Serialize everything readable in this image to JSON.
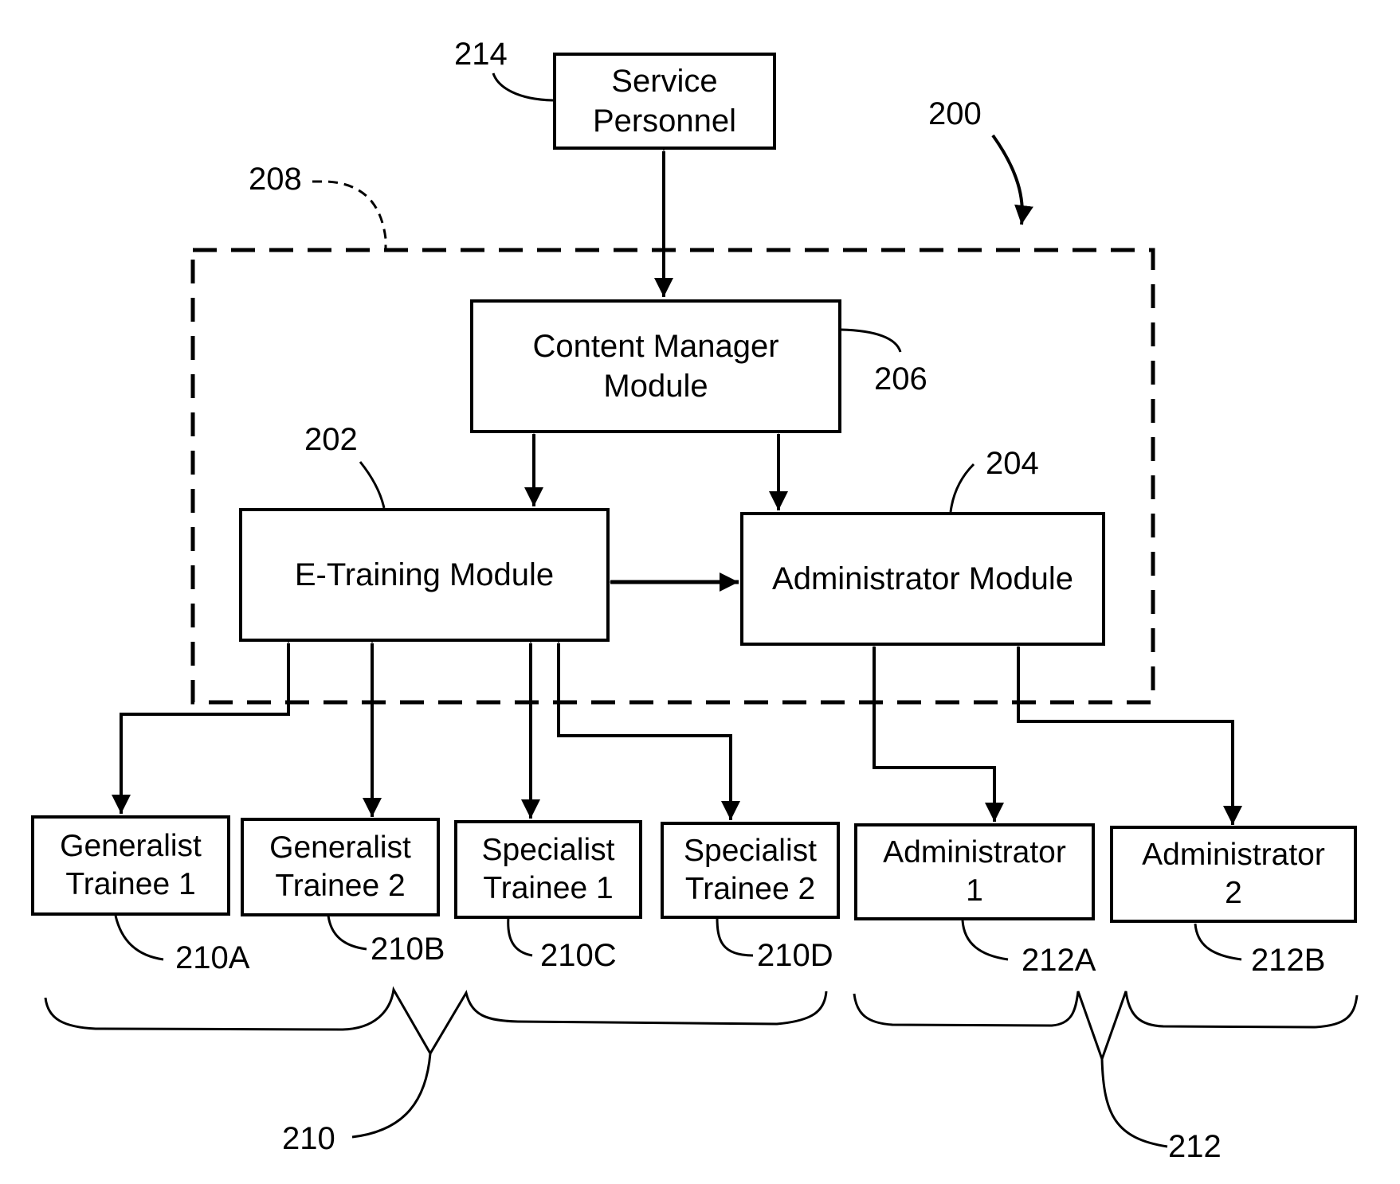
{
  "figure": {
    "system_ref": "200",
    "boundary_ref": "208"
  },
  "service_personnel": {
    "lines": [
      "Service",
      "Personnel"
    ],
    "ref": "214"
  },
  "content_manager": {
    "lines": [
      "Content Manager",
      "Module"
    ],
    "ref": "206"
  },
  "e_training": {
    "lines": [
      "E-Training Module"
    ],
    "ref": "202"
  },
  "administrator_module": {
    "lines": [
      "Administrator Module"
    ],
    "ref": "204"
  },
  "trainees": {
    "group_ref": "210",
    "items": [
      {
        "lines": [
          "Generalist",
          "Trainee 1"
        ],
        "ref": "210A"
      },
      {
        "lines": [
          "Generalist",
          "Trainee 2"
        ],
        "ref": "210B"
      },
      {
        "lines": [
          "Specialist",
          "Trainee 1"
        ],
        "ref": "210C"
      },
      {
        "lines": [
          "Specialist",
          "Trainee 2"
        ],
        "ref": "210D"
      }
    ]
  },
  "administrators": {
    "group_ref": "212",
    "items": [
      {
        "lines": [
          "Administrator",
          "1"
        ],
        "ref": "212A"
      },
      {
        "lines": [
          "Administrator",
          "2"
        ],
        "ref": "212B"
      }
    ]
  }
}
